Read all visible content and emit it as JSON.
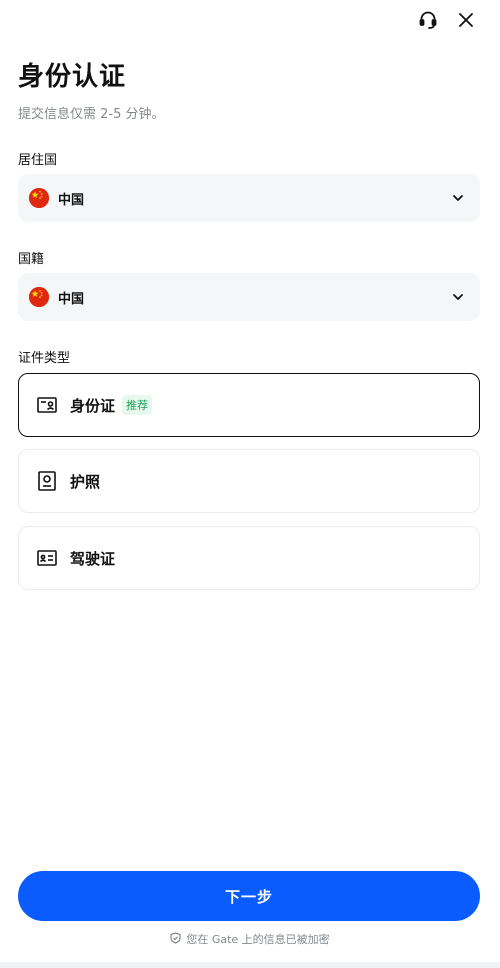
{
  "header": {
    "support_icon": "headset-icon",
    "close_icon": "close-icon"
  },
  "page": {
    "title": "身份认证",
    "subtitle": "提交信息仅需 2-5 分钟。"
  },
  "residence": {
    "label": "居住国",
    "value": "中国",
    "flag_icon": "china-flag-icon"
  },
  "nationality": {
    "label": "国籍",
    "value": "中国",
    "flag_icon": "china-flag-icon"
  },
  "document_type": {
    "label": "证件类型",
    "options": [
      {
        "label": "身份证",
        "badge": "推荐",
        "icon": "id-card-icon",
        "selected": true
      },
      {
        "label": "护照",
        "icon": "passport-icon",
        "selected": false
      },
      {
        "label": "驾驶证",
        "icon": "driver-license-icon",
        "selected": false
      }
    ]
  },
  "actions": {
    "next_label": "下一步"
  },
  "footer": {
    "security_note": "您在 Gate 上的信息已被加密",
    "shield_icon": "shield-icon"
  },
  "colors": {
    "primary": "#0a5cff",
    "badge_text": "#1fa35b",
    "badge_bg": "#e9f8ef",
    "field_bg": "#f5f6f7",
    "muted_text": "#84888c"
  }
}
